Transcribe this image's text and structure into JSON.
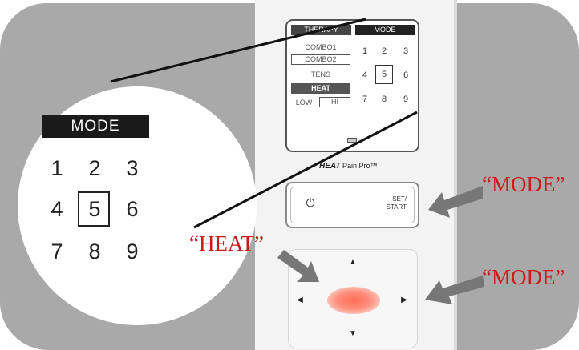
{
  "magnifier": {
    "mode_label": "MODE",
    "digits": [
      "1",
      "2",
      "3",
      "4",
      "5",
      "6",
      "7",
      "8",
      "9"
    ],
    "selected_digit": "5"
  },
  "lcd": {
    "therapy_label": "THERAPY",
    "mode_label": "MODE",
    "therapy_options": {
      "combo1": "COMBO1",
      "combo2": "COMBO2",
      "tens": "TENS",
      "heat": "HEAT"
    },
    "heat_level": {
      "low": "LOW",
      "high": "HI"
    },
    "digits": [
      "1",
      "2",
      "3",
      "4",
      "5",
      "6",
      "7",
      "8",
      "9"
    ],
    "selected_digit": "5"
  },
  "brand": {
    "bold": "HEAT",
    "rest": "Pain Pro™"
  },
  "control_button": {
    "power_symbol": "⏻",
    "set_start_line1": "SET/",
    "set_start_line2": "START"
  },
  "dpad": {
    "up": "▲",
    "down": "▼",
    "left": "◀",
    "right": "▶"
  },
  "annotations": {
    "mode_top": "“MODE”",
    "mode_bottom": "“MODE”",
    "heat": "“HEAT”"
  },
  "colors": {
    "panel_grey": "#a9a9a9",
    "label_red": "#cc1a1a",
    "heat_glow": "#ff6e55",
    "arrow_grey": "#777777"
  }
}
